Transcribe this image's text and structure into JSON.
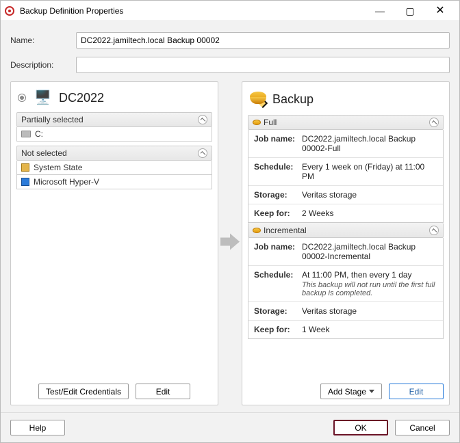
{
  "window": {
    "title": "Backup Definition Properties"
  },
  "form": {
    "nameLabel": "Name:",
    "nameValue": "DC2022.jamiltech.local Backup 00002",
    "descLabel": "Description:",
    "descValue": ""
  },
  "leftPanel": {
    "title": "DC2022",
    "sections": {
      "partial": {
        "head": "Partially selected",
        "items": [
          "C:"
        ]
      },
      "notsel": {
        "head": "Not selected",
        "items": [
          "System State",
          "Microsoft Hyper-V"
        ]
      }
    },
    "buttons": {
      "cred": "Test/Edit Credentials",
      "edit": "Edit"
    }
  },
  "rightPanel": {
    "title": "Backup",
    "full": {
      "head": "Full",
      "jobNameKey": "Job name:",
      "jobNameVal": "DC2022.jamiltech.local Backup 00002-Full",
      "schedKey": "Schedule:",
      "schedVal": "Every 1 week on (Friday) at 11:00 PM",
      "storageKey": "Storage:",
      "storageVal": "Veritas storage",
      "keepKey": "Keep for:",
      "keepVal": "2 Weeks"
    },
    "incr": {
      "head": "Incremental",
      "jobNameKey": "Job name:",
      "jobNameVal": "DC2022.jamiltech.local Backup 00002-Incremental",
      "schedKey": "Schedule:",
      "schedVal": "At 11:00 PM, then every 1 day",
      "schedNote": "This backup will not run until the first full backup is completed.",
      "storageKey": "Storage:",
      "storageVal": "Veritas storage",
      "keepKey": "Keep for:",
      "keepVal": "1 Week"
    },
    "buttons": {
      "stage": "Add Stage",
      "edit": "Edit"
    }
  },
  "footer": {
    "help": "Help",
    "ok": "OK",
    "cancel": "Cancel"
  },
  "winBtns": {
    "min": "—",
    "max": "▢",
    "close": "✕"
  }
}
